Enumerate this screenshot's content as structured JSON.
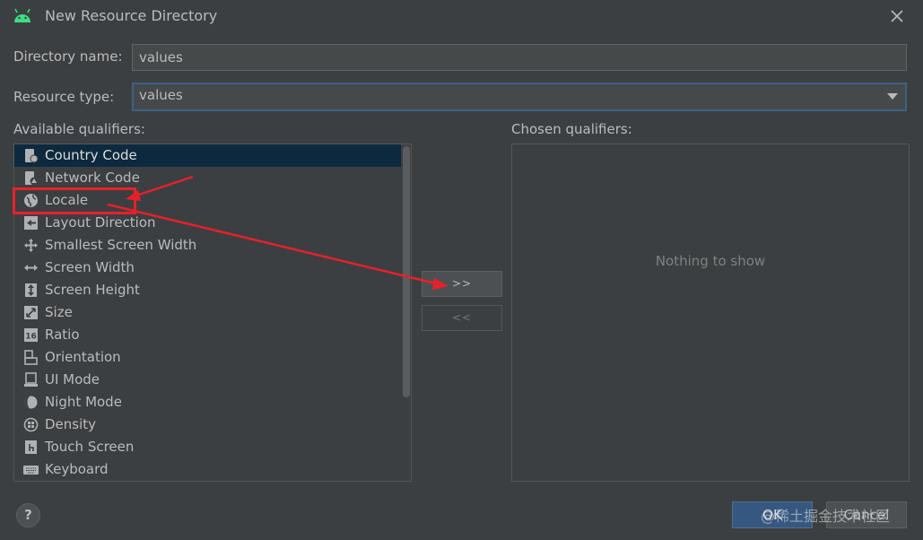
{
  "window": {
    "title": "New Resource Directory",
    "app_icon": "android-icon",
    "close_icon": "close-icon"
  },
  "directory_name": {
    "label": "Directory name:",
    "value": "values"
  },
  "resource_type": {
    "label": "Resource type:",
    "value": "values"
  },
  "available": {
    "label": "Available qualifiers:",
    "selected_index": 0,
    "items": [
      {
        "label": "Country Code",
        "icon": "country-code-icon"
      },
      {
        "label": "Network Code",
        "icon": "network-code-icon"
      },
      {
        "label": "Locale",
        "icon": "globe-icon"
      },
      {
        "label": "Layout Direction",
        "icon": "layout-direction-icon"
      },
      {
        "label": "Smallest Screen Width",
        "icon": "arrows-all-icon"
      },
      {
        "label": "Screen Width",
        "icon": "arrows-horizontal-icon"
      },
      {
        "label": "Screen Height",
        "icon": "arrows-vertical-icon"
      },
      {
        "label": "Size",
        "icon": "size-icon"
      },
      {
        "label": "Ratio",
        "icon": "ratio-icon"
      },
      {
        "label": "Orientation",
        "icon": "orientation-icon"
      },
      {
        "label": "UI Mode",
        "icon": "ui-mode-icon"
      },
      {
        "label": "Night Mode",
        "icon": "night-mode-icon"
      },
      {
        "label": "Density",
        "icon": "density-icon"
      },
      {
        "label": "Touch Screen",
        "icon": "touch-screen-icon"
      },
      {
        "label": "Keyboard",
        "icon": "keyboard-icon"
      }
    ]
  },
  "buttons": {
    "add": ">>",
    "remove": "<<",
    "help": "?",
    "ok": "OK",
    "cancel": "Cancel"
  },
  "chosen": {
    "label": "Chosen qualifiers:",
    "empty": "Nothing to show"
  },
  "watermark": "@稀土掘金技术社区",
  "colors": {
    "background": "#3c3f41",
    "selection": "#0d293e",
    "primary_button": "#365880",
    "annotation": "#e8202a",
    "android": "#3ddc84"
  }
}
